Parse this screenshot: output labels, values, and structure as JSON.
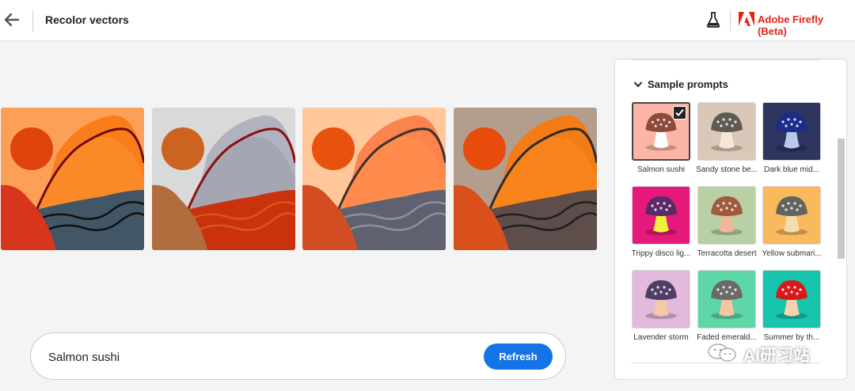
{
  "header": {
    "title": "Recolor vectors",
    "brand": "Adobe Firefly (Beta)",
    "back_icon": "arrow-left-icon",
    "lab_icon": "flask-icon"
  },
  "thumbnails": [
    {
      "name": "variation-1",
      "palette": {
        "bg": "#fca058",
        "back_hill": "#fa7d1c",
        "front_hill": "#fa8a28",
        "sun": "#e0440c",
        "left": "#d8361c",
        "water": "#415666",
        "line": "#6a0d0d",
        "wave": "#111111"
      }
    },
    {
      "name": "variation-2",
      "palette": {
        "bg": "#d9d9d9",
        "back_hill": "#b1b2bf",
        "front_hill": "#a5a6b4",
        "sun": "#cd6320",
        "left": "#b26d3e",
        "water": "#c9320c",
        "line": "#8b0f0f",
        "wave": "#d8561e"
      }
    },
    {
      "name": "variation-3",
      "palette": {
        "bg": "#ffc79a",
        "back_hill": "#fb834d",
        "front_hill": "#ff8b4c",
        "sun": "#e8510e",
        "left": "#d24e22",
        "water": "#5f6170",
        "line": "#3c3030",
        "wave": "#8d8fa2"
      }
    },
    {
      "name": "variation-4",
      "palette": {
        "bg": "#b39e8e",
        "back_hill": "#f47c16",
        "front_hill": "#f9841c",
        "sun": "#e84c0c",
        "left": "#d9501a",
        "water": "#5e4d4a",
        "line": "#2b2b2b",
        "wave": "#1f1f1f"
      }
    }
  ],
  "prompt": {
    "value": "Salmon sushi",
    "refresh_label": "Refresh"
  },
  "panel": {
    "section_title": "Sample prompts",
    "chevron_icon": "chevron-down-icon",
    "samples": [
      {
        "label": "Salmon sushi",
        "selected": true,
        "bg": "#fbb5a6",
        "cap": "#8b4a3a",
        "stem": "#ffffff"
      },
      {
        "label": "Sandy stone be...",
        "selected": false,
        "bg": "#d9c8b8",
        "cap": "#5f5a54",
        "stem": "#f5e8d8"
      },
      {
        "label": "Dark blue mid...",
        "selected": false,
        "bg": "#2d3560",
        "cap": "#1b2d88",
        "stem": "#b9c8ee"
      },
      {
        "label": "Trippy disco lig...",
        "selected": false,
        "bg": "#e5197a",
        "cap": "#582a66",
        "stem": "#f1f03a"
      },
      {
        "label": "Terracotta desert",
        "selected": false,
        "bg": "#b7d0a4",
        "cap": "#a05a3e",
        "stem": "#f0b89a"
      },
      {
        "label": "Yellow submari...",
        "selected": false,
        "bg": "#f9b95c",
        "cap": "#62645e",
        "stem": "#f2dcb2"
      },
      {
        "label": "Lavender storm",
        "selected": false,
        "bg": "#e3b9dc",
        "cap": "#4f3e66",
        "stem": "#f4c9a8"
      },
      {
        "label": "Faded emerald...",
        "selected": false,
        "bg": "#5ed6a8",
        "cap": "#6a6a6a",
        "stem": "#f5c5a5"
      },
      {
        "label": "Summer by th...",
        "selected": false,
        "bg": "#17c4ae",
        "cap": "#d51a1a",
        "stem": "#f7d2b0"
      }
    ]
  },
  "watermark": {
    "text": "AI研习站",
    "icon": "wechat-icon"
  }
}
